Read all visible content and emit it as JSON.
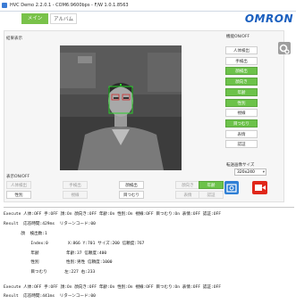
{
  "window": {
    "title": "HVC Demo 2.2.0.1 - COM6:9600bps - F/W 1.0.1.8563"
  },
  "tabs": [
    {
      "label": "メイン",
      "active": true
    },
    {
      "label": "アルバム",
      "active": false
    }
  ],
  "logo": "OMRON",
  "left_panel": {
    "results_label": "結果表示"
  },
  "right_panel": {
    "func_label": "機能ON/OFF",
    "buttons": [
      {
        "label": "人体検出",
        "state": "white"
      },
      {
        "label": "手検出",
        "state": "white"
      },
      {
        "label": "顔検出",
        "state": "on"
      },
      {
        "label": "顔向き",
        "state": "on"
      },
      {
        "label": "年齢",
        "state": "on"
      },
      {
        "label": "性別",
        "state": "on"
      },
      {
        "label": "視線",
        "state": "white"
      },
      {
        "label": "目つむり",
        "state": "on"
      },
      {
        "label": "表情",
        "state": "white"
      },
      {
        "label": "認証",
        "state": "white"
      }
    ],
    "image_size_label": "転送画像サイズ",
    "image_size_value": "320x240"
  },
  "display_onoff": {
    "label": "表示ON/OFF",
    "row1": [
      {
        "label": "人体検出",
        "state": "off"
      },
      {
        "label": "手検出",
        "state": "off"
      },
      {
        "label": "顔検出",
        "state": "bon"
      },
      {
        "label": "顔向き",
        "state": "off"
      },
      {
        "label": "年齢",
        "state": "on"
      }
    ],
    "row2": [
      {
        "label": "性別",
        "state": "bon"
      },
      {
        "label": "視線",
        "state": "off"
      },
      {
        "label": "目つむり",
        "state": "bon"
      },
      {
        "label": "表情",
        "state": "off"
      },
      {
        "label": "認証",
        "state": "off"
      }
    ]
  },
  "log_lines": [
    "Execute 人体:OFF 手:OFF 顔:On 顔向き:OFF 年齢:On 性別:On 視線:OFF 目つむり:On 表情:OFF 認証:OFF",
    "Result  応答時間:429ms  リターンコード:00",
    "       顔  検出数:1",
    "           Index:0        X:866 Y:701 サイズ:200 信頼度:767",
    "           年齢           年齢:37 信頼度:400",
    "           性別           性別:男性 信頼度:1000",
    "           目つむり       左:227 右:233",
    "",
    "Execute 人体:OFF 手:OFF 顔:On 顔向き:OFF 年齢:On 性別:On 視線:OFF 目つむり:On 表情:OFF 認証:OFF",
    "Result  応答時間:441ms  リターンコード:00"
  ]
}
